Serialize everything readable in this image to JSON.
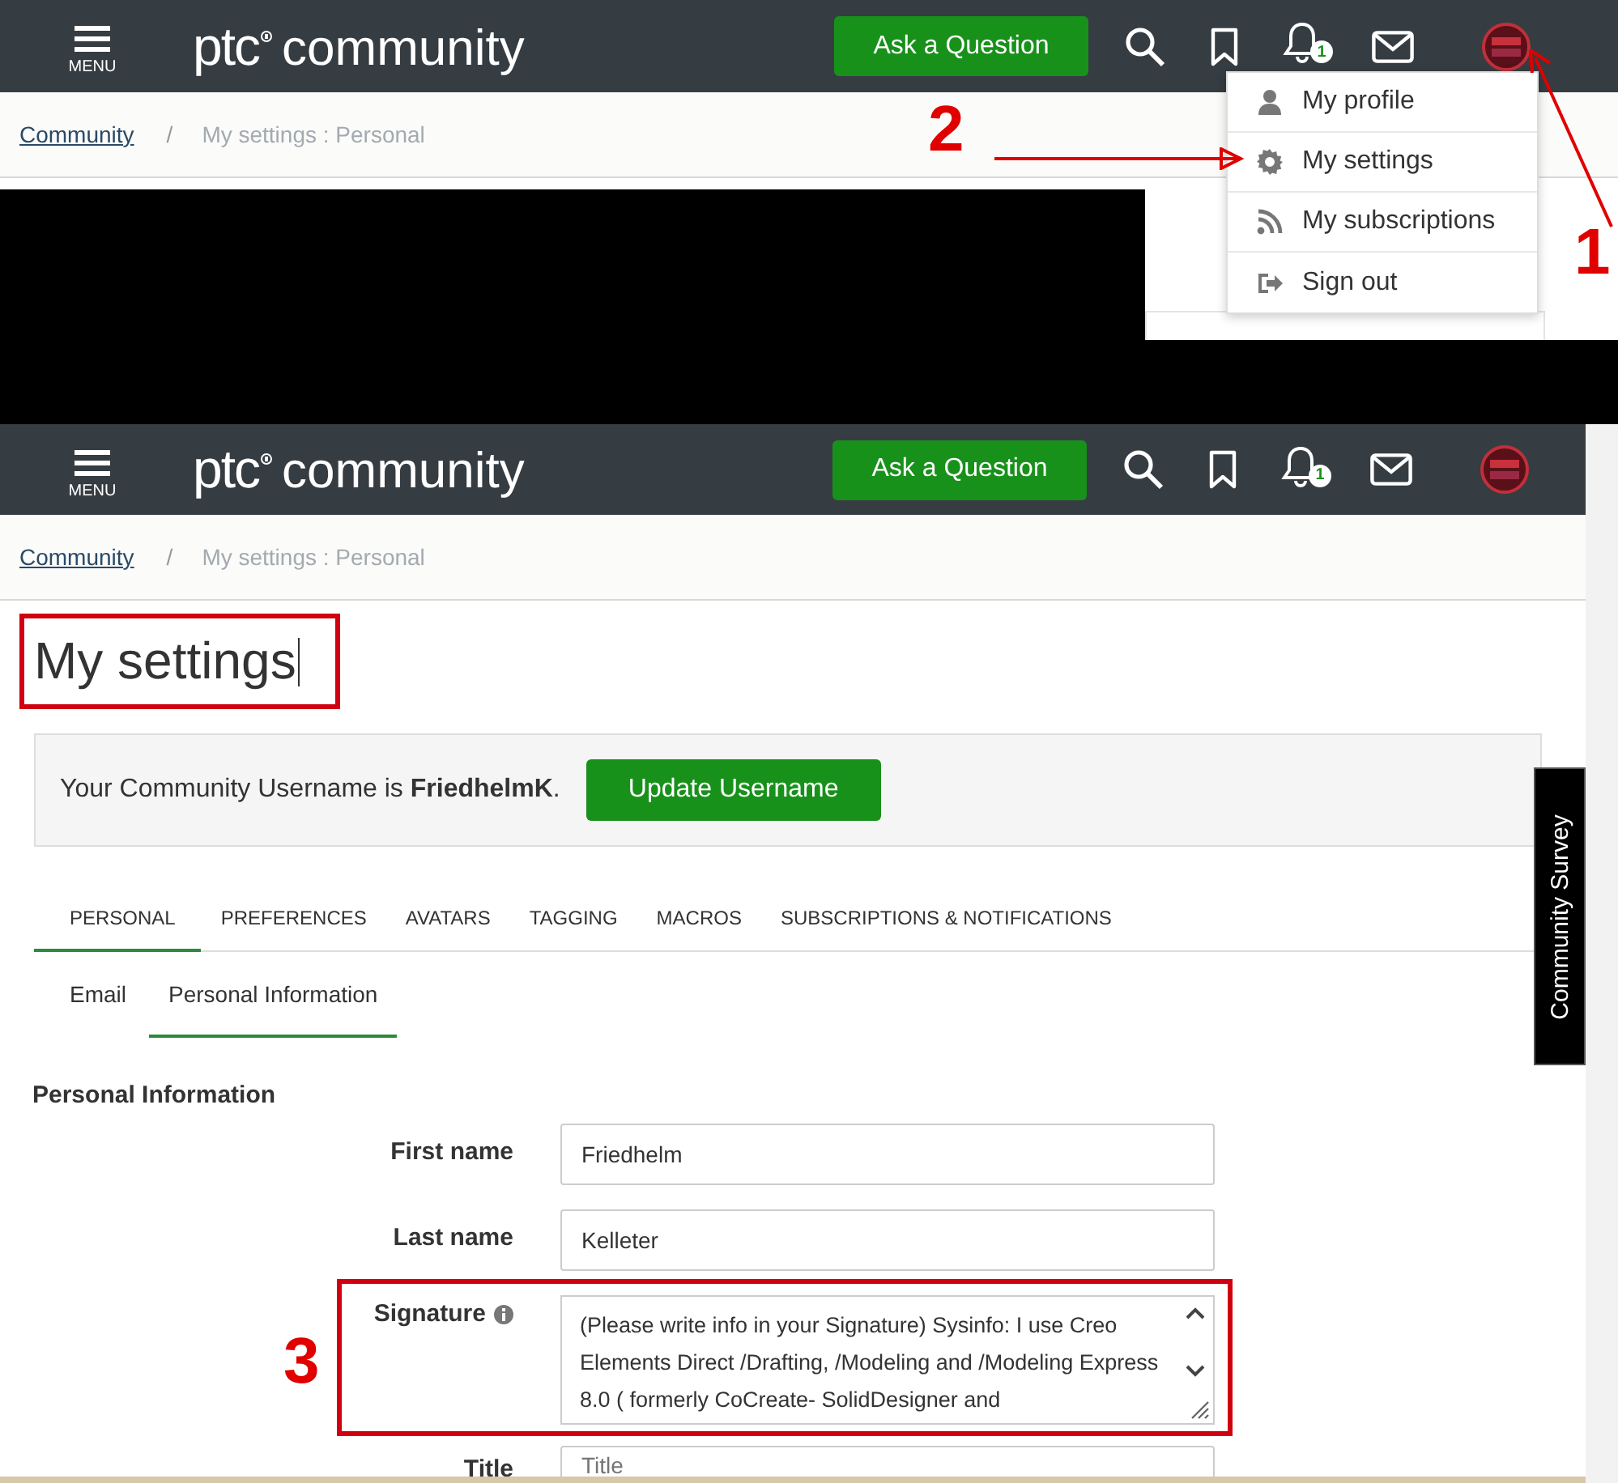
{
  "top_capture": {
    "header": {
      "menu_label": "MENU",
      "logo_prefix": "ptc",
      "logo_text": "community",
      "ask_button": "Ask a Question",
      "notification_count": "1"
    },
    "breadcrumb": {
      "link": "Community",
      "separator": "/",
      "current": "My settings : Personal"
    },
    "user_menu": {
      "items": [
        {
          "kind": "profile",
          "label": "My profile"
        },
        {
          "kind": "settings",
          "label": "My settings"
        },
        {
          "kind": "subscriptions",
          "label": "My subscriptions"
        },
        {
          "kind": "signout",
          "label": "Sign out"
        }
      ]
    }
  },
  "settings_page": {
    "header": {
      "menu_label": "MENU",
      "logo_prefix": "ptc",
      "logo_text": "community",
      "ask_button": "Ask a Question",
      "notification_count": "1"
    },
    "breadcrumb": {
      "link": "Community",
      "separator": "/",
      "current": "My settings : Personal"
    },
    "title": "My settings",
    "username_banner": {
      "text": "Your Community Username is **FriedhelmK**.",
      "button": "Update Username"
    },
    "tabs": [
      {
        "label": "PERSONAL",
        "selected": true
      },
      {
        "label": "PREFERENCES",
        "selected": false
      },
      {
        "label": "AVATARS",
        "selected": false
      },
      {
        "label": "TAGGING",
        "selected": false
      },
      {
        "label": "MACROS",
        "selected": false
      },
      {
        "label": "SUBSCRIPTIONS & NOTIFICATIONS",
        "selected": false
      }
    ],
    "subtabs": [
      {
        "label": "Email",
        "selected": false
      },
      {
        "label": "Personal Information",
        "selected": true
      }
    ],
    "section_title": "Personal Information",
    "fields": [
      {
        "kind": "input",
        "label": "First name",
        "value": "Friedhelm"
      },
      {
        "kind": "input",
        "label": "Last name",
        "value": "Kelleter"
      },
      {
        "kind": "textarea",
        "label": "Signature",
        "value": "(Please write info in your Signature) Sysinfo: I use Creo Elements Direct /Drafting, /Modeling and /Modeling Express 8.0 ( formerly CoCreate- SolidDesigner and"
      },
      {
        "kind": "input",
        "label": "Title",
        "placeholder": "Title"
      }
    ],
    "survey_tab": "Community Survey"
  },
  "annotations": [
    {
      "label": "1"
    },
    {
      "label": "2"
    },
    {
      "label": "3"
    }
  ]
}
